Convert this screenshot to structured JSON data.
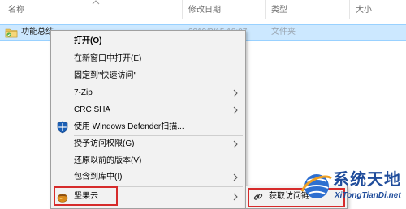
{
  "header": {
    "columns": [
      {
        "label": "名称"
      },
      {
        "label": "修改日期"
      },
      {
        "label": "类型"
      },
      {
        "label": "大小"
      }
    ]
  },
  "file_row": {
    "name": "功能总结",
    "date": "2019/3/15 18:07",
    "type": "文件夹",
    "icon": "folder-icon"
  },
  "context_menu": {
    "items": [
      {
        "label": "打开(O)",
        "bold": true
      },
      {
        "label": "在新窗口中打开(E)"
      },
      {
        "label": "固定到\"快速访问\""
      },
      {
        "label": "7-Zip",
        "has_submenu": true
      },
      {
        "label": "CRC SHA",
        "has_submenu": true
      },
      {
        "label": "使用 Windows Defender扫描...",
        "icon": "windows-defender-shield-icon"
      },
      {
        "label": "授予访问权限(G)",
        "has_submenu": true
      },
      {
        "label": "还原以前的版本(V)"
      },
      {
        "label": "包含到库中(I)",
        "has_submenu": true
      },
      {
        "label": "坚果云",
        "has_submenu": true,
        "icon": "jianguoyun-nut-icon",
        "highlighted": true
      }
    ]
  },
  "submenu": {
    "label": "获取访问链",
    "icon": "link-icon",
    "highlighted": true
  },
  "watermark": {
    "cn": "系统天地",
    "en": "XiTongTianDi.net"
  },
  "colors": {
    "selection_bg": "#cce8ff",
    "highlight_border": "#d62b2b",
    "watermark_blue": "#1f4c9b",
    "menu_bg": "#f2f2f2"
  }
}
